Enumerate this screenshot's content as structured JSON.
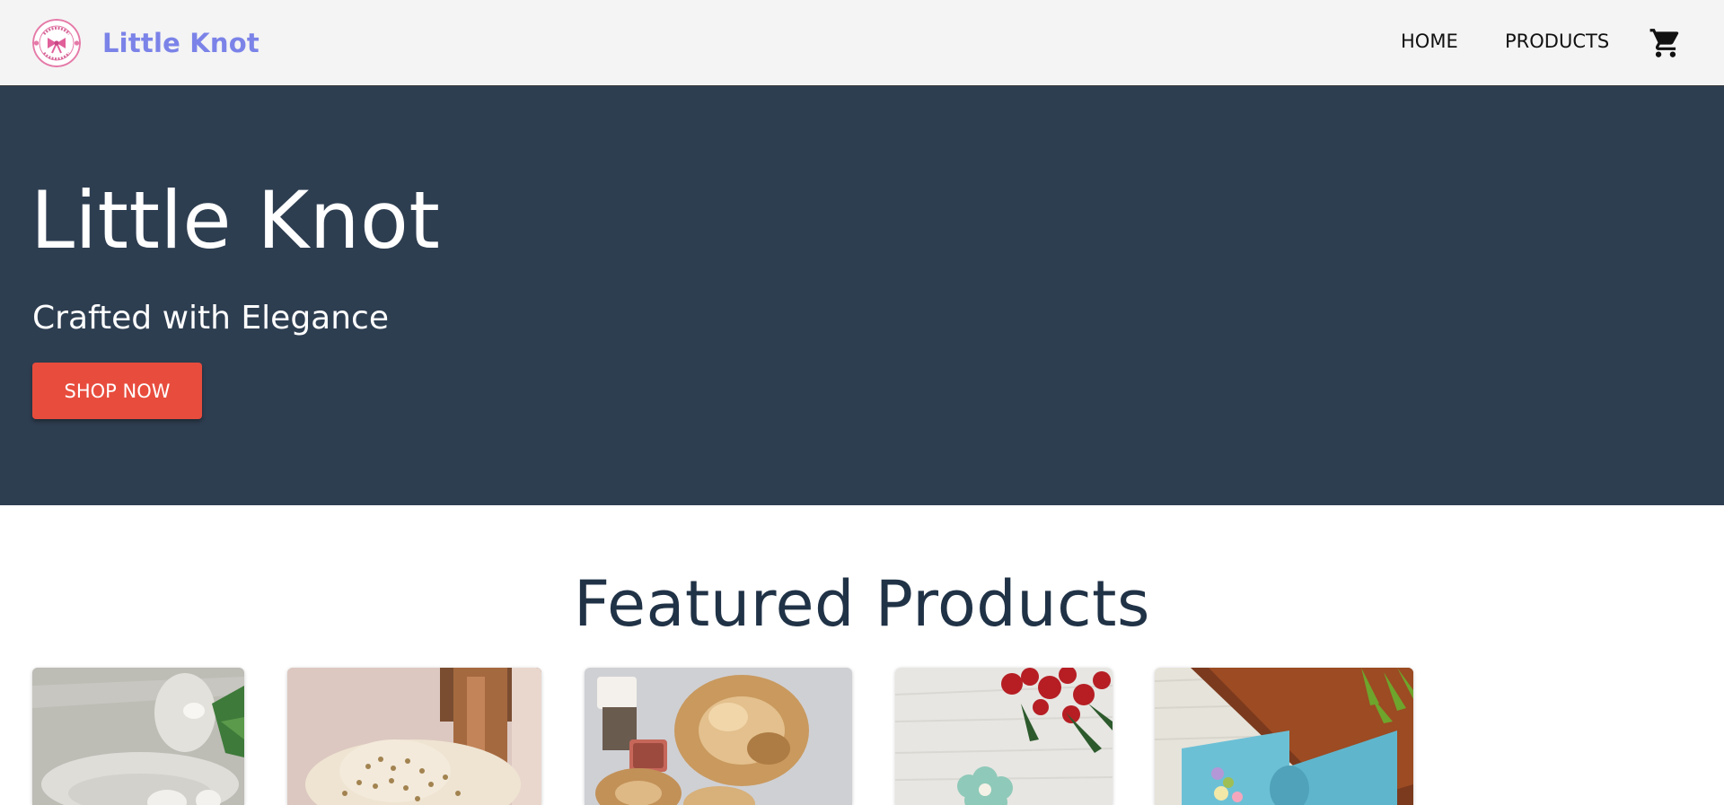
{
  "header": {
    "brand_name": "Little Knot",
    "logo_text_top": "LITTLE KNOT",
    "logo_text_bottom": "HANDICRAFTS",
    "nav": {
      "home": "HOME",
      "products": "PRODUCTS"
    },
    "cart_icon": "shopping-cart-icon"
  },
  "hero": {
    "title": "Little Knot",
    "subtitle": "Crafted with Elegance",
    "cta_label": "SHOP NOW"
  },
  "featured": {
    "title": "Featured Products",
    "products": [
      {
        "image": "white-scrunchie-photo"
      },
      {
        "image": "floral-scrunchie-photo"
      },
      {
        "image": "gold-satin-scrunchie-photo"
      },
      {
        "image": "mint-flower-clip-photo"
      },
      {
        "image": "blue-bow-photo"
      }
    ]
  },
  "colors": {
    "brand": "#7b83e8",
    "hero_bg": "#2e3e51",
    "cta": "#e84c3d",
    "heading": "#203246",
    "navbar_bg": "#f4f4f4"
  }
}
